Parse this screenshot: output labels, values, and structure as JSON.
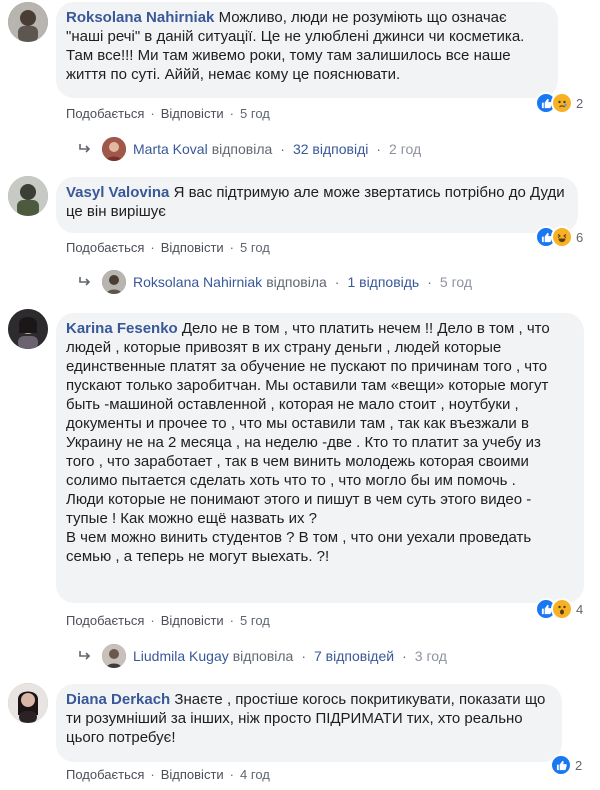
{
  "actions": {
    "like": "Подобається",
    "reply": "Відповісти",
    "dot": "·"
  },
  "comments": [
    {
      "author": "Roksolana Nahirniak",
      "text": "Можливо, люди не розуміють що означає \"наші речі\" в даній ситуації. Це не улюблені джинси чи косметика. Там все!!! Ми там живемо роки, тому там залишилось все наше життя по суті. Аййй, немає кому це пояснювати.",
      "time": "5 год",
      "reaction_count": "2",
      "reactions": [
        "like-reaction-icon",
        "sad-reaction-icon"
      ],
      "reply": {
        "name": "Marta Koval",
        "verb": "відповіла",
        "count": "32 відповіді",
        "time": "2 год"
      }
    },
    {
      "author": "Vasyl Valovina",
      "text": "Я вас підтримую але може звертатись потрібно до Дуди це він вирішує",
      "time": "5 год",
      "reaction_count": "6",
      "reactions": [
        "like-reaction-icon",
        "haha-reaction-icon"
      ],
      "reply": {
        "name": "Roksolana Nahirniak",
        "verb": "відповіла",
        "count": "1 відповідь",
        "time": "5 год"
      }
    },
    {
      "author": "Karina Fesenko",
      "text": "Дело не в том , что платить нечем !! Дело в том , что людей , которые привозят в их страну деньги , людей которые единственные платят за обучение не пускают по причинам того , что пускают только заробитчан. Мы оставили там «вещи» которые могут быть -машиной оставленной , которая не мало стоит , ноутбуки , документы и прочее то , что мы оставили там , так как въезжали в Украину не на 2 месяца , на неделю -две . Кто то платит за учебу из того , что заработает , так в чем винить молодежь которая своими солимо пытается сделать хоть что то , что могло бы им помочь .\nЛюди которые не понимают этого и пишут в чем суть этого видео - тупые ! Как можно ещё назвать их ?\nВ чем можно винить студентов ? В том , что они уехали проведать семью , а теперь не могут выехать. ?!",
      "time": "5 год",
      "reaction_count": "4",
      "reactions": [
        "like-reaction-icon",
        "wow-reaction-icon"
      ],
      "reply": {
        "name": "Liudmila Kugay",
        "verb": "відповіла",
        "count": "7 відповідей",
        "time": "3 год"
      }
    },
    {
      "author": "Diana Derkach",
      "text": "Знаєте , простіше когось покритикувати, показати що ти розумніший за інших, ніж просто ПІДРИМАТИ тих, хто реально цього потребує!",
      "time": "4 год",
      "reaction_count": "2",
      "reactions": [
        "like-reaction-icon"
      ]
    }
  ],
  "colors": {
    "link": "#385898",
    "bubble": "#f2f3f5",
    "meta": "#606770",
    "like": "#1877f2"
  }
}
